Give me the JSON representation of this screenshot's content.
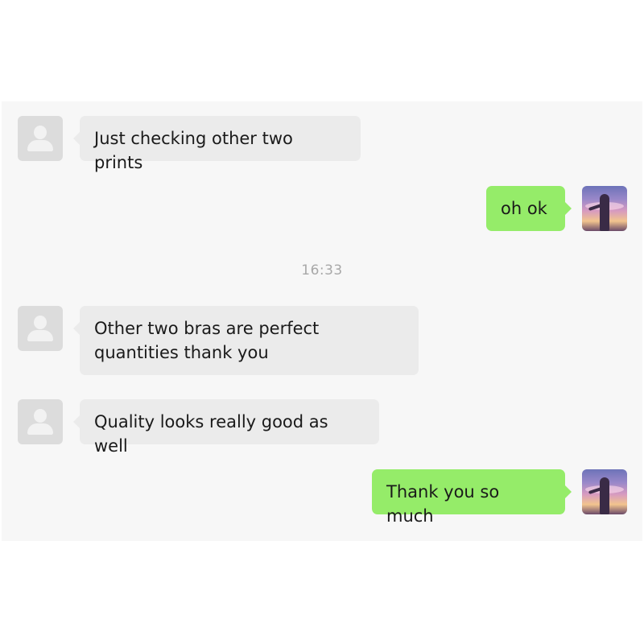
{
  "chat": {
    "colors": {
      "incoming_bubble": "#ebebeb",
      "outgoing_bubble": "#95ec69",
      "panel_background": "#f7f7f7",
      "timestamp_text": "#a8a8a8"
    },
    "messages": [
      {
        "direction": "incoming",
        "avatar": "default-avatar-icon",
        "text": "Just checking other two prints"
      },
      {
        "direction": "outgoing",
        "avatar": "user-photo-avatar",
        "text": "oh ok"
      },
      {
        "direction": "incoming",
        "avatar": "default-avatar-icon",
        "text": "Other two bras are perfect quantities thank you"
      },
      {
        "direction": "incoming",
        "avatar": "default-avatar-icon",
        "text": "Quality looks really good as well"
      },
      {
        "direction": "outgoing",
        "avatar": "user-photo-avatar",
        "text": "Thank you so much"
      }
    ],
    "timestamp": "16:33"
  }
}
